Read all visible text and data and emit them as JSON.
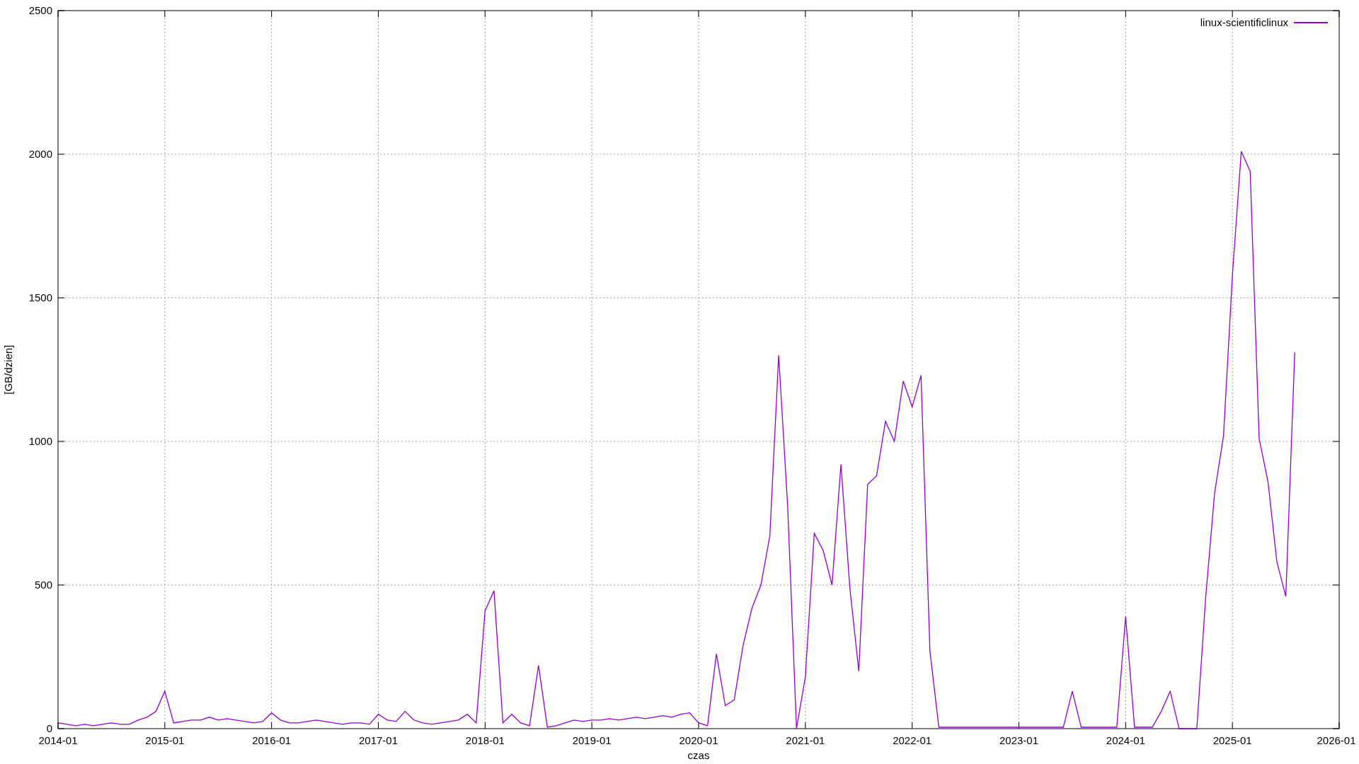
{
  "chart_data": {
    "type": "line",
    "grid": true,
    "xlabel": "czas",
    "ylabel": "[GB/dzien]",
    "ylim": [
      0,
      2500
    ],
    "yticks": [
      0,
      500,
      1000,
      1500,
      2000,
      2500
    ],
    "categories": [
      "2014-01",
      null,
      null,
      null,
      null,
      null,
      null,
      null,
      null,
      null,
      null,
      null,
      "2015-01",
      null,
      null,
      null,
      null,
      null,
      null,
      null,
      null,
      null,
      null,
      null,
      "2016-01",
      null,
      null,
      null,
      null,
      null,
      null,
      null,
      null,
      null,
      null,
      null,
      "2017-01",
      null,
      null,
      null,
      null,
      null,
      null,
      null,
      null,
      null,
      null,
      null,
      "2018-01",
      null,
      null,
      null,
      null,
      null,
      null,
      null,
      null,
      null,
      null,
      null,
      "2019-01",
      null,
      null,
      null,
      null,
      null,
      null,
      null,
      null,
      null,
      null,
      null,
      "2020-01",
      null,
      null,
      null,
      null,
      null,
      null,
      null,
      null,
      null,
      null,
      null,
      "2021-01",
      null,
      null,
      null,
      null,
      null,
      null,
      null,
      null,
      null,
      null,
      null,
      "2022-01",
      null,
      null,
      null,
      null,
      null,
      null,
      null,
      null,
      null,
      null,
      null,
      "2023-01",
      null,
      null,
      null,
      null,
      null,
      null,
      null,
      null,
      null,
      null,
      null,
      "2024-01",
      null,
      null,
      null,
      null,
      null,
      null,
      null,
      null,
      null,
      null,
      null,
      "2025-01",
      null,
      null,
      null,
      null,
      null,
      null,
      null,
      null,
      null,
      null,
      null,
      "2026-01"
    ],
    "series": [
      {
        "name": "linux-scientificlinux",
        "color": "#9400d3",
        "values": [
          20,
          15,
          10,
          15,
          10,
          15,
          20,
          15,
          15,
          30,
          40,
          60,
          130,
          20,
          25,
          30,
          30,
          40,
          30,
          35,
          30,
          25,
          20,
          25,
          55,
          30,
          20,
          20,
          25,
          30,
          25,
          20,
          15,
          20,
          20,
          15,
          50,
          30,
          25,
          60,
          30,
          20,
          15,
          20,
          25,
          30,
          50,
          20,
          410,
          480,
          20,
          50,
          20,
          10,
          220,
          5,
          10,
          20,
          30,
          25,
          30,
          30,
          35,
          30,
          35,
          40,
          35,
          40,
          45,
          40,
          50,
          55,
          20,
          10,
          260,
          80,
          100,
          290,
          420,
          500,
          670,
          1300,
          780,
          0,
          180,
          680,
          620,
          500,
          920,
          490,
          200,
          850,
          880,
          1070,
          1000,
          1210,
          1120,
          1230,
          270,
          5,
          5,
          5,
          5,
          5,
          5,
          5,
          5,
          5,
          5,
          5,
          5,
          5,
          5,
          5,
          130,
          5,
          5,
          5,
          5,
          5,
          390,
          5,
          5,
          5,
          60,
          130,
          0,
          0,
          0,
          460,
          820,
          1020,
          1580,
          2010,
          1940,
          1010,
          860,
          580,
          460,
          1310,
          null,
          null,
          null,
          null,
          null
        ]
      }
    ]
  }
}
